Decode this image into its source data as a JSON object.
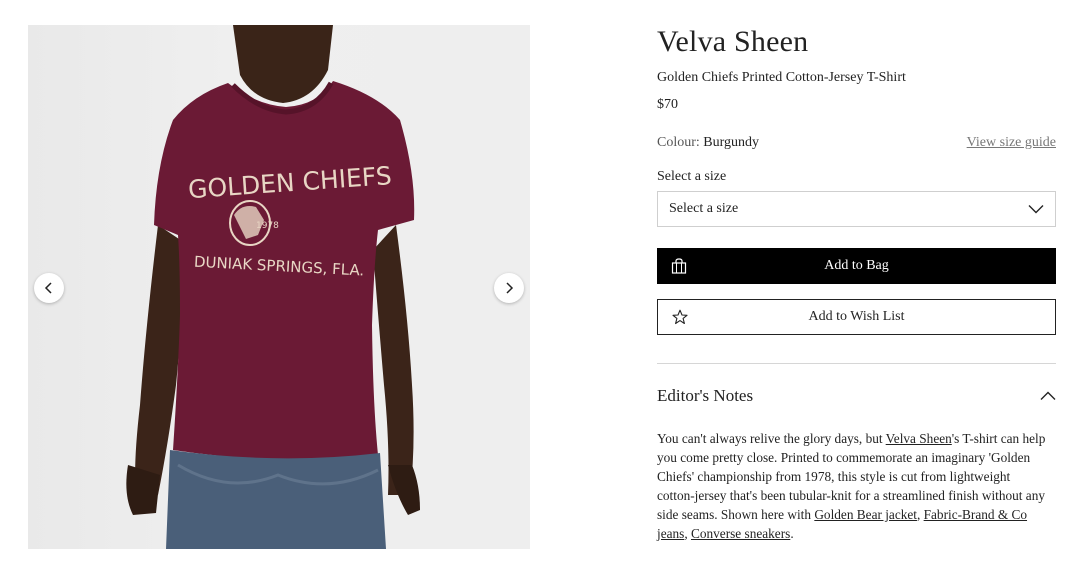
{
  "product": {
    "brand": "Velva Sheen",
    "name": "Golden Chiefs Printed Cotton-Jersey T-Shirt",
    "price": "$70",
    "colour_label": "Colour:",
    "colour_value": "Burgundy",
    "size_guide_label": "View size guide"
  },
  "gallery": {
    "shirt_print_line1": "GOLDEN CHIEFS",
    "shirt_print_year": "1978",
    "shirt_print_line2": "DUNIAK SPRINGS, FLA.",
    "colors": {
      "shirt": "#6b1a35",
      "background": "#ececec"
    }
  },
  "size": {
    "label": "Select a size",
    "selected": "Select a size"
  },
  "actions": {
    "add_to_bag": "Add to Bag",
    "add_to_wishlist": "Add to Wish List"
  },
  "editors_notes": {
    "title": "Editor's Notes",
    "text_1": "You can't always relive the glory days, but ",
    "link_brand": "Velva Sheen",
    "text_2": "'s T-shirt can help you come pretty close. Printed to commemorate an imaginary 'Golden Chiefs' championship from 1978, this style is cut from lightweight cotton-jersey that's been tubular-knit for a streamlined finish without any side seams. Shown here with ",
    "link_jacket": "Golden Bear jacket",
    "text_3": ", ",
    "link_jeans": "Fabric-Brand & Co jeans",
    "text_4": ", ",
    "link_sneakers": "Converse sneakers",
    "text_5": "."
  }
}
